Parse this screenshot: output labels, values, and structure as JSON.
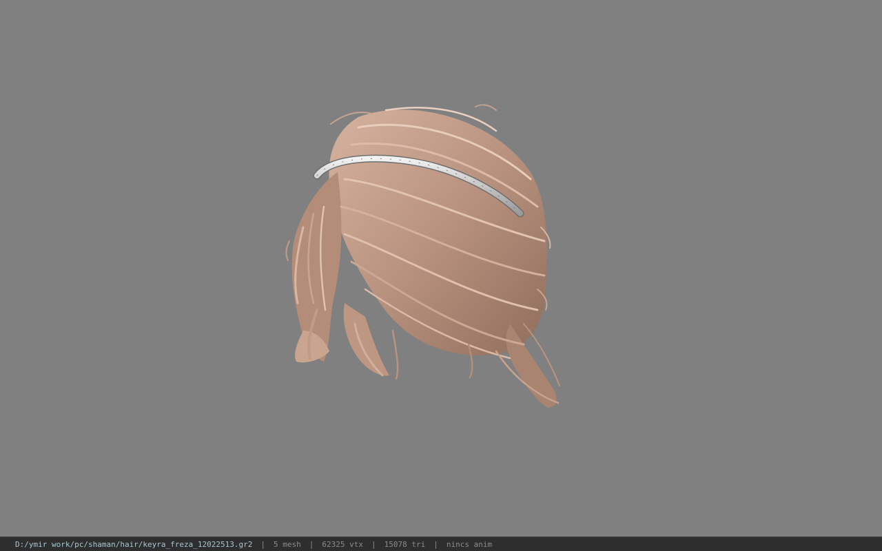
{
  "viewer": {
    "background_color": "#808080",
    "model_icon": "hair-model-with-headband"
  },
  "statusbar": {
    "file_path": "D:/ymir work/pc/shaman/hair/keyra_freza_12022513.gr2",
    "separator": "|",
    "mesh_count": "5 mesh",
    "vertex_count": "62325 vtx",
    "triangle_count": "15078 tri",
    "anim_status": "nincs anim"
  }
}
